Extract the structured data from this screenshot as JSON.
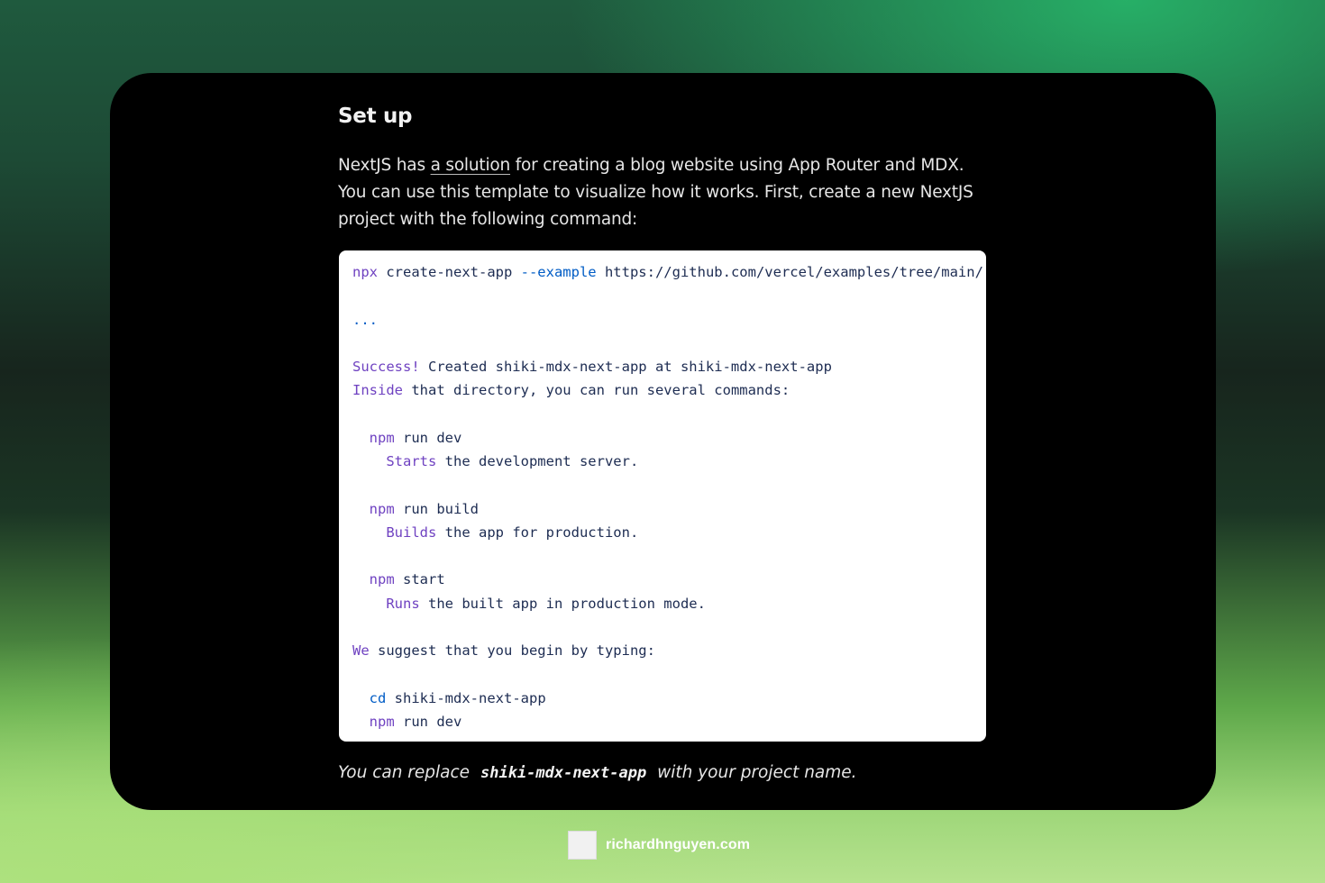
{
  "section": {
    "heading": "Set up",
    "intro_before_link": "NextJS has ",
    "intro_link": "a solution",
    "intro_after_link": " for creating a blog website using App Router and MDX. You can use this template to visualize how it works. First, create a new NextJS project with the following command:"
  },
  "code": {
    "lines": [
      {
        "k": "npx",
        "rest": " create-next-app ",
        "opt": "--example",
        "tail": " https://github.com/vercel/examples/tree/main/"
      },
      {
        "k": "",
        "rest": ""
      },
      {
        "k": "...",
        "rest": ""
      },
      {
        "k": "",
        "rest": ""
      },
      {
        "k": "Success!",
        "rest": " Created shiki-mdx-next-app at shiki-mdx-next-app"
      },
      {
        "k": "Inside",
        "rest": " that directory, you can run several commands:"
      },
      {
        "k": "",
        "rest": ""
      },
      {
        "indent": "  ",
        "k": "npm",
        "rest": " run dev"
      },
      {
        "indent": "    ",
        "k": "Starts",
        "rest": " the development server."
      },
      {
        "k": "",
        "rest": ""
      },
      {
        "indent": "  ",
        "k": "npm",
        "rest": " run build"
      },
      {
        "indent": "    ",
        "k": "Builds",
        "rest": " the app for production."
      },
      {
        "k": "",
        "rest": ""
      },
      {
        "indent": "  ",
        "k": "npm",
        "rest": " start"
      },
      {
        "indent": "    ",
        "k": "Runs",
        "rest": " the built app in production mode."
      },
      {
        "k": "",
        "rest": ""
      },
      {
        "k": "We",
        "rest": " suggest that you begin by typing:"
      },
      {
        "k": "",
        "rest": ""
      },
      {
        "indent": "  ",
        "k": "cd",
        "rest": " shiki-mdx-next-app",
        "blue": true
      },
      {
        "indent": "  ",
        "k": "npm",
        "rest": " run dev"
      }
    ]
  },
  "footnote": {
    "before": "You can replace",
    "code": "shiki-mdx-next-app",
    "after": "with your project name."
  },
  "brand": {
    "logo_icon": "site-logo-icon",
    "text": "richardhnguyen.com"
  },
  "colors": {
    "keyword": "#6f42c1",
    "builtin": "#005cc5",
    "code_text": "#1d2c52"
  }
}
